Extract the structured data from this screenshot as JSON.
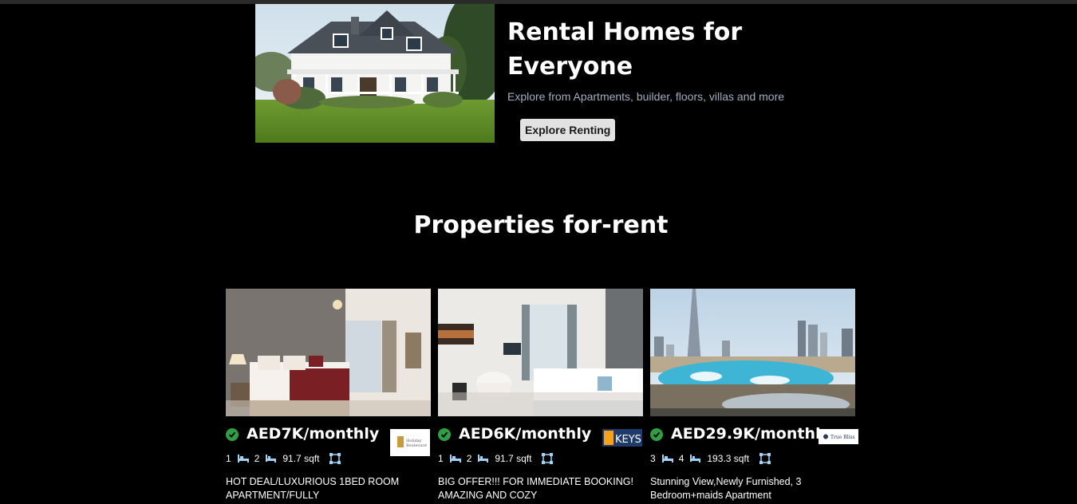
{
  "hero": {
    "title": "Rental Homes for Everyone",
    "subtitle": "Explore from Apartments, builder, floors, villas and more",
    "button_label": "Explore Renting"
  },
  "section": {
    "title": "Properties for-rent"
  },
  "icons": {
    "verified": "check-circle-icon",
    "rooms": "bed-icon",
    "baths": "bath-icon",
    "area": "area-icon"
  },
  "colors": {
    "background": "#000000",
    "verified_green": "#2f9e44",
    "button_bg": "#e2e2e2",
    "subtitle": "#a0aec0",
    "spec_icon": "#9fd3f5"
  },
  "properties": [
    {
      "price": "AED7K/monthly",
      "rooms": "1",
      "baths": "2",
      "area": "91.7 sqft",
      "title": "HOT DEAL/LUXURIOUS 1BED ROOM APARTMENT/FULLY",
      "agency_logo": "Holiday Boulevard"
    },
    {
      "price": "AED6K/monthly",
      "rooms": "1",
      "baths": "2",
      "area": "91.7 sqft",
      "title": "BIG OFFER!!! FOR IMMEDIATE BOOKING! AMAZING AND COZY",
      "agency_logo": "KEYS"
    },
    {
      "price": "AED29.9K/monthly",
      "rooms": "3",
      "baths": "4",
      "area": "193.3 sqft",
      "title": "Stunning View,Newly Furnished, 3 Bedroom+maids Apartment",
      "agency_logo": "True Bliss"
    }
  ]
}
